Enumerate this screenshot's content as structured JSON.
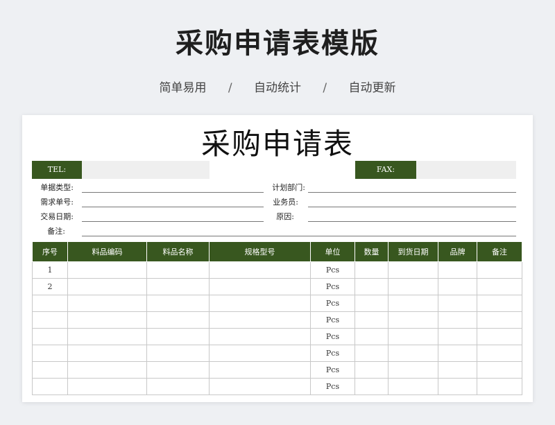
{
  "banner": {
    "title": "采购申请表模版",
    "taglines": [
      "简单易用",
      "自动统计",
      "自动更新"
    ],
    "separator": "/"
  },
  "sheet": {
    "title": "采购申请表",
    "tel_label": "TEL:",
    "fax_label": "FAX:",
    "fields": {
      "doc_type": "单据类型:",
      "plan_dept": "计划部门:",
      "req_no": "需求单号:",
      "salesperson": "业务员:",
      "trade_date": "交易日期:",
      "reason": "原因:",
      "remark": "备注:"
    },
    "columns": [
      "序号",
      "料品编码",
      "料品名称",
      "规格型号",
      "单位",
      "数量",
      "到货日期",
      "品牌",
      "备注"
    ],
    "rows": [
      {
        "no": "1",
        "unit": "Pcs"
      },
      {
        "no": "2",
        "unit": "Pcs"
      },
      {
        "no": "",
        "unit": "Pcs"
      },
      {
        "no": "",
        "unit": "Pcs"
      },
      {
        "no": "",
        "unit": "Pcs"
      },
      {
        "no": "",
        "unit": "Pcs"
      },
      {
        "no": "",
        "unit": "Pcs"
      },
      {
        "no": "",
        "unit": "Pcs"
      }
    ]
  },
  "colors": {
    "header_green": "#38571f",
    "page_bg": "#eef0f3"
  }
}
